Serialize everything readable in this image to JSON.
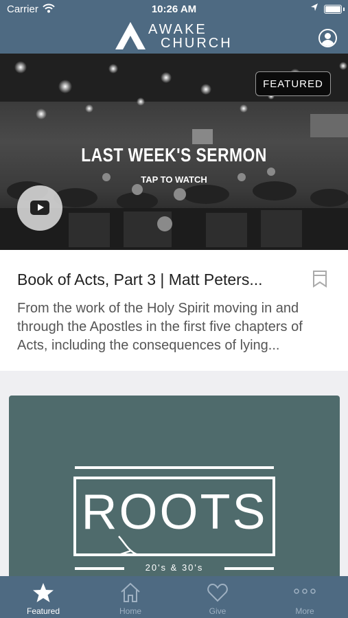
{
  "status": {
    "carrier": "Carrier",
    "time": "10:26 AM"
  },
  "header": {
    "brand_line1": "AWAKE",
    "brand_line2": "CHURCH"
  },
  "hero": {
    "badge": "FEATURED",
    "title": "LAST WEEK'S SERMON",
    "subtitle": "TAP TO WATCH"
  },
  "sermon": {
    "title": "Book of Acts, Part 3 | Matt Peters...",
    "description": "From the work of the Holy Spirit moving in and through the Apostles in the first five chapters of Acts, including the consequences of lying..."
  },
  "promo": {
    "name": "ROOTS",
    "tagline": "20's & 30's"
  },
  "tabs": [
    {
      "label": "Featured",
      "icon": "star-icon",
      "active": true
    },
    {
      "label": "Home",
      "icon": "home-icon",
      "active": false
    },
    {
      "label": "Give",
      "icon": "heart-icon",
      "active": false
    },
    {
      "label": "More",
      "icon": "more-icon",
      "active": false
    }
  ],
  "colors": {
    "header": "#4e6a82",
    "tab_active": "#ffffff",
    "tab_inactive": "#9fb1c2",
    "promo_bg": "#4f6b6c"
  }
}
